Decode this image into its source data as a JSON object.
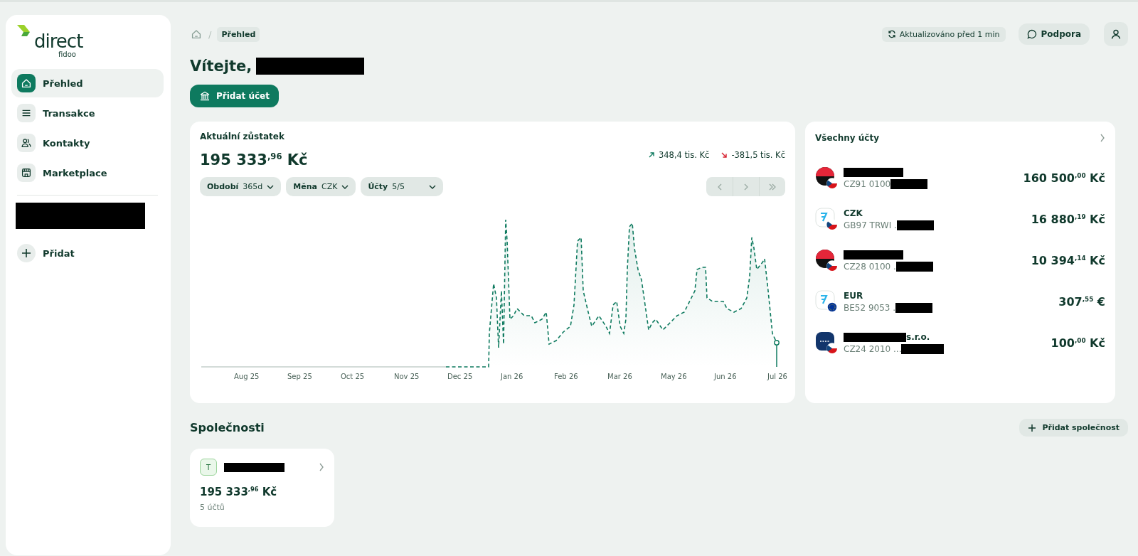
{
  "sidebar": {
    "logo": {
      "word": "direct",
      "sub": "fidoo"
    },
    "items": [
      {
        "label": "Přehled",
        "kind": "home",
        "selected": true
      },
      {
        "label": "Transakce",
        "kind": "list",
        "selected": false
      },
      {
        "label": "Kontakty",
        "kind": "people",
        "selected": false
      },
      {
        "label": "Marketplace",
        "kind": "store",
        "selected": false
      }
    ],
    "company_redacted": true,
    "add_label": "Přidat"
  },
  "header": {
    "separator": "/",
    "breadcrumb": "Přehled",
    "updated": "Aktualizováno před 1 min",
    "support": "Podpora"
  },
  "greeting": {
    "text": "Vítejte,",
    "name_redacted": true
  },
  "add_account": "Přidat účet",
  "balance": {
    "title": "Aktuální zůstatek",
    "amount": "195 333$^{,96}$ Kč",
    "income": "348,4 tis. Kč",
    "expense": "-381,5 tis. Kč",
    "filters": [
      {
        "label": "Období",
        "value": "365d"
      },
      {
        "label": "Měna",
        "value": "CZK"
      },
      {
        "label": "Účty",
        "value": "5/5"
      }
    ],
    "x_labels": [
      "Aug 25",
      "Sep 25",
      "Oct 25",
      "Nov 25",
      "Dec 25",
      "Jan 26",
      "Feb 26",
      "Mar 26",
      "May 26",
      "Jun 26",
      "Jul 26"
    ]
  },
  "accounts": {
    "title": "Všechny účty",
    "items": [
      {
        "kind": "bank",
        "name_redacted": true,
        "iban": "CZ91 0100",
        "amount": "160 500$^{,00}$ Kč"
      },
      {
        "kind": "wallet",
        "name": "CZK",
        "name_redacted": false,
        "iban": "GB97 TRWI .",
        "amount": "16 880$^{,19}$ Kč"
      },
      {
        "kind": "bank",
        "name_redacted": true,
        "iban": "CZ28 0100 .",
        "amount": "10 394$^{,14}$ Kč"
      },
      {
        "kind": "euwallet",
        "name": "EUR",
        "name_redacted": false,
        "iban": "BE52 9053 .",
        "amount": "307$^{,55}$ €"
      },
      {
        "kind": "card",
        "name": "s.r.o.",
        "name_redacted": true,
        "iban": "CZ24 2010 ...",
        "amount": "100$^{,00}$ Kč"
      }
    ]
  },
  "companies": {
    "title": "Společnosti",
    "add": "Přidat společnost",
    "items": [
      {
        "initial": "T",
        "name_redacted": true,
        "amount": "195 333$^{,96}$ Kč",
        "count": "5 účtů"
      }
    ]
  }
}
